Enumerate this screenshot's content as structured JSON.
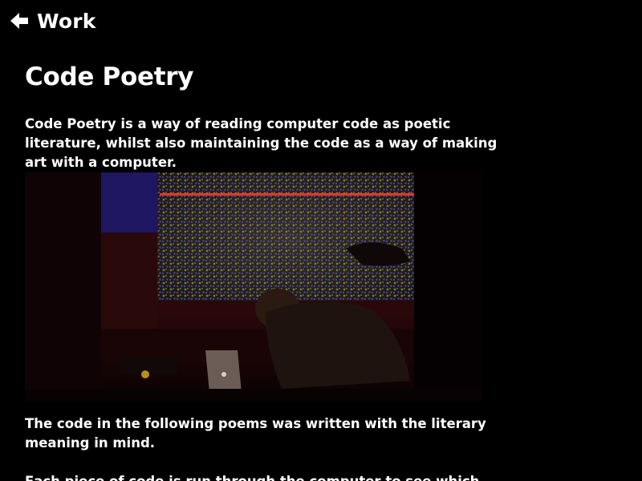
{
  "nav": {
    "back_label": "Work",
    "back_icon": "arrow-left-icon"
  },
  "main": {
    "title": "Code Poetry",
    "intro": "Code Poetry is a way of reading computer code as poetic literature, whilst also maintaining the code as a way of making art with a computer.",
    "hero_image": {
      "icon": "performance-photo"
    },
    "paragraphs": [
      "The code in the following poems was written with the literary meaning in mind.",
      "Each piece of code is run through the computer to see which..."
    ]
  },
  "colors": {
    "background": "#000000",
    "text": "#ffffff"
  }
}
